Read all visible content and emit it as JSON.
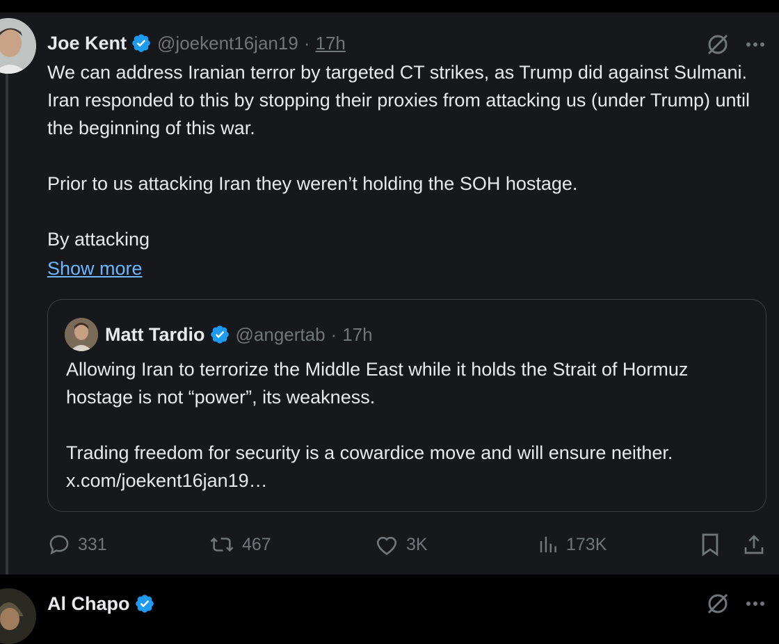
{
  "colors": {
    "background": "#000000",
    "card": "#16181c",
    "text": "#e7e9ea",
    "muted": "#71767b",
    "link": "#6cb6ff",
    "verified": "#1d9bf0",
    "border": "#3e4144"
  },
  "tweet": {
    "author": {
      "display_name": "Joe Kent",
      "handle": "@joekent16jan19",
      "verified": true,
      "avatar_icon": "profile-photo"
    },
    "separator": "·",
    "time": "17h",
    "grok_icon": "grok-icon",
    "more_icon": "more-dots-icon",
    "text_paragraphs": [
      "We can address Iranian terror by targeted CT strikes, as Trump did against Sulmani. Iran responded to this by stopping their proxies from attacking us (under Trump) until the beginning of this war.",
      "Prior to us attacking Iran they weren’t holding the SOH hostage.",
      "By attacking"
    ],
    "show_more": "Show more",
    "quote": {
      "author": {
        "display_name": "Matt Tardio",
        "handle": "@angertab",
        "verified": true
      },
      "separator": "·",
      "time": "17h",
      "text_paragraphs": [
        "Allowing Iran to terrorize the Middle East while it holds the Strait of Hormuz hostage is not “power”, its weakness.",
        "Trading freedom for security is a cowardice move and will ensure neither. x.com/joekent16jan19…"
      ]
    },
    "actions": {
      "replies": "331",
      "reposts": "467",
      "likes": "3K",
      "views": "173K"
    }
  },
  "next_tweet": {
    "author": {
      "display_name": "Al Chapo",
      "verified": true
    }
  }
}
